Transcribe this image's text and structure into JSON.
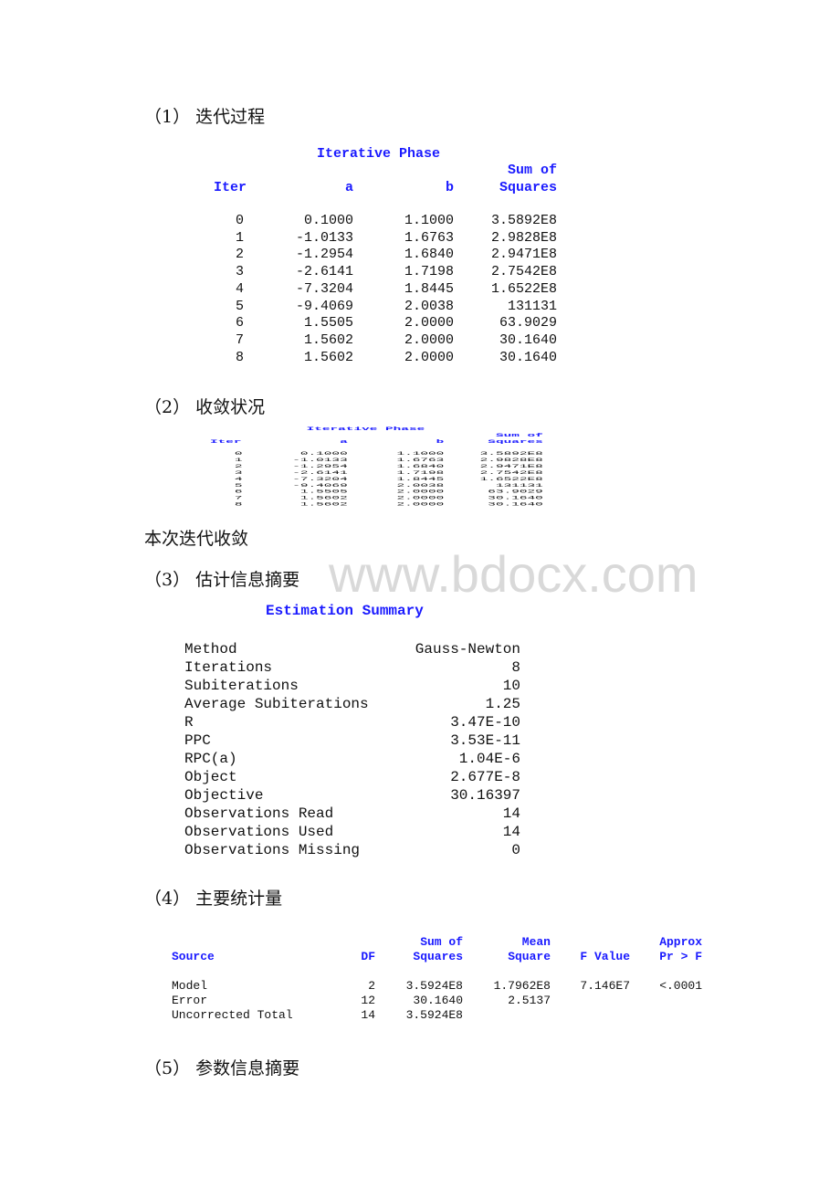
{
  "watermark": "www.bdocx.com",
  "sections": {
    "s1": {
      "heading": "（1） 迭代过程"
    },
    "s2": {
      "heading": "（2） 收敛状况"
    },
    "converged_note": "本次迭代收敛",
    "s3": {
      "heading": "（3） 估计信息摘要"
    },
    "s4": {
      "heading": "（4） 主要统计量"
    },
    "s5": {
      "heading": "（5） 参数信息摘要"
    }
  },
  "iterative_phase": {
    "title": "Iterative Phase",
    "headers": {
      "iter": "Iter",
      "a": "a",
      "b": "b",
      "ss_line1": "Sum of",
      "ss_line2": "Squares"
    },
    "rows": [
      {
        "iter": "0",
        "a": "0.1000",
        "b": "1.1000",
        "ss": "3.5892E8"
      },
      {
        "iter": "1",
        "a": "-1.0133",
        "b": "1.6763",
        "ss": "2.9828E8"
      },
      {
        "iter": "2",
        "a": "-1.2954",
        "b": "1.6840",
        "ss": "2.9471E8"
      },
      {
        "iter": "3",
        "a": "-2.6141",
        "b": "1.7198",
        "ss": "2.7542E8"
      },
      {
        "iter": "4",
        "a": "-7.3204",
        "b": "1.8445",
        "ss": "1.6522E8"
      },
      {
        "iter": "5",
        "a": "-9.4069",
        "b": "2.0038",
        "ss": "131131"
      },
      {
        "iter": "6",
        "a": "1.5505",
        "b": "2.0000",
        "ss": "63.9029"
      },
      {
        "iter": "7",
        "a": "1.5602",
        "b": "2.0000",
        "ss": "30.1640"
      },
      {
        "iter": "8",
        "a": "1.5602",
        "b": "2.0000",
        "ss": "30.1640"
      }
    ]
  },
  "estimation_summary": {
    "title": "Estimation Summary",
    "rows": [
      {
        "label": "Method",
        "value": "Gauss-Newton"
      },
      {
        "label": "Iterations",
        "value": "8"
      },
      {
        "label": "Subiterations",
        "value": "10"
      },
      {
        "label": "Average Subiterations",
        "value": "1.25"
      },
      {
        "label": "R",
        "value": "3.47E-10"
      },
      {
        "label": "PPC",
        "value": "3.53E-11"
      },
      {
        "label": "RPC(a)",
        "value": "1.04E-6"
      },
      {
        "label": "Object",
        "value": "2.677E-8"
      },
      {
        "label": "Objective",
        "value": "30.16397"
      },
      {
        "label": "Observations Read",
        "value": "14"
      },
      {
        "label": "Observations Used",
        "value": "14"
      },
      {
        "label": "Observations Missing",
        "value": "0"
      }
    ]
  },
  "anova": {
    "headers": {
      "source": "Source",
      "df": "DF",
      "ss_line1": "Sum of",
      "ss_line2": "Squares",
      "ms_line1": "Mean",
      "ms_line2": "Square",
      "f": "F Value",
      "p_line1": "Approx",
      "p_line2": "Pr > F"
    },
    "rows": [
      {
        "source": "Model",
        "df": "2",
        "ss": "3.5924E8",
        "ms": "1.7962E8",
        "f": "7.146E7",
        "p": "<.0001"
      },
      {
        "source": "Error",
        "df": "12",
        "ss": "30.1640",
        "ms": "2.5137",
        "f": "",
        "p": ""
      },
      {
        "source": "Uncorrected Total",
        "df": "14",
        "ss": "3.5924E8",
        "ms": "",
        "f": "",
        "p": ""
      }
    ]
  },
  "colors": {
    "header_blue": "#1a1aff",
    "text": "#111111",
    "watermark": "#d9d9d9"
  }
}
